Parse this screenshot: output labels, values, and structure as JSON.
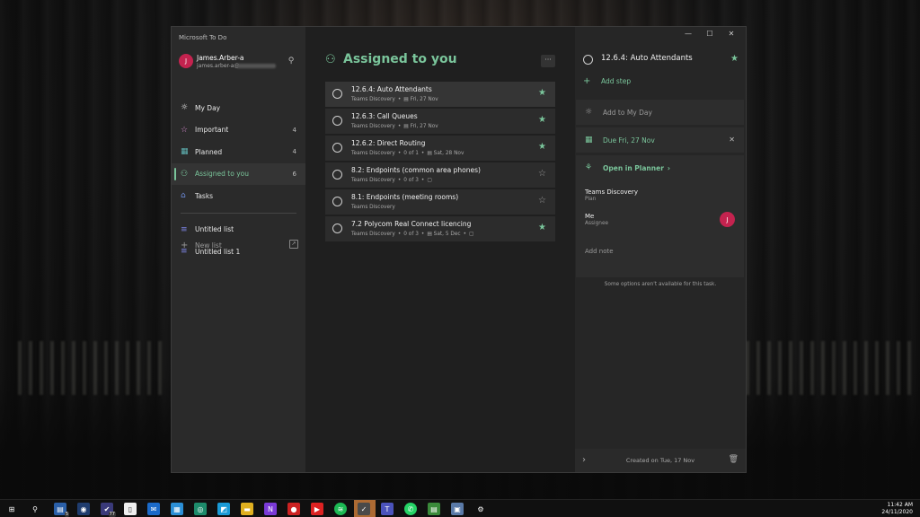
{
  "app": {
    "title": "Microsoft To Do",
    "accent": "#7ac59b"
  },
  "account": {
    "initial": "J",
    "name": "James.Arber-a",
    "email": "james.arber-a@"
  },
  "sidebar": {
    "items": [
      {
        "icon": "sun-icon",
        "glyph": "☼",
        "label": "My Day",
        "count": ""
      },
      {
        "icon": "star-icon",
        "glyph": "☆",
        "label": "Important",
        "count": "4"
      },
      {
        "icon": "calendar-icon",
        "glyph": "▦",
        "label": "Planned",
        "count": "4"
      },
      {
        "icon": "person-icon",
        "glyph": "⚇",
        "label": "Assigned to you",
        "count": "6"
      },
      {
        "icon": "home-icon",
        "glyph": "⌂",
        "label": "Tasks",
        "count": ""
      }
    ],
    "lists": [
      {
        "icon": "list-icon",
        "glyph": "≡",
        "label": "Untitled list"
      },
      {
        "icon": "list-icon",
        "glyph": "≡",
        "label": "Untitled list 1"
      }
    ],
    "new_list_label": "New list"
  },
  "main": {
    "title": "Assigned to you",
    "more_glyph": "···",
    "tasks": [
      {
        "title": "12.6.4: Auto Attendants",
        "list": "Teams Discovery",
        "steps": "",
        "due": "Fri, 27 Nov",
        "note": false,
        "important": true
      },
      {
        "title": "12.6.3: Call Queues",
        "list": "Teams Discovery",
        "steps": "",
        "due": "Fri, 27 Nov",
        "note": false,
        "important": true
      },
      {
        "title": "12.6.2: Direct Routing",
        "list": "Teams Discovery",
        "steps": "0 of 1",
        "due": "Sat, 28 Nov",
        "note": false,
        "important": true
      },
      {
        "title": "8.2: Endpoints (common area phones)",
        "list": "Teams Discovery",
        "steps": "0 of 3",
        "due": "",
        "note": true,
        "important": false
      },
      {
        "title": "8.1: Endpoints (meeting rooms)",
        "list": "Teams Discovery",
        "steps": "",
        "due": "",
        "note": false,
        "important": false
      },
      {
        "title": "7.2 Polycom Real Connect licencing",
        "list": "Teams Discovery",
        "steps": "0 of 3",
        "due": "Sat, 5 Dec",
        "note": true,
        "important": true
      }
    ]
  },
  "detail": {
    "title": "12.6.4: Auto Attendants",
    "add_step": "Add step",
    "add_to_my_day": "Add to My Day",
    "due": "Due Fri, 27 Nov",
    "open_in_planner": "Open in Planner",
    "plan_name": "Teams Discovery",
    "plan_label": "Plan",
    "assignee_name": "Me",
    "assignee_label": "Assignee",
    "assignee_initial": "J",
    "note_placeholder": "Add note",
    "options_message": "Some options aren't available for this task.",
    "created": "Created on Tue, 17 Nov"
  },
  "taskbar": {
    "time": "11:42 AM",
    "date": "24/11/2020",
    "badges": {
      "files": "5",
      "vscode": "77"
    }
  }
}
